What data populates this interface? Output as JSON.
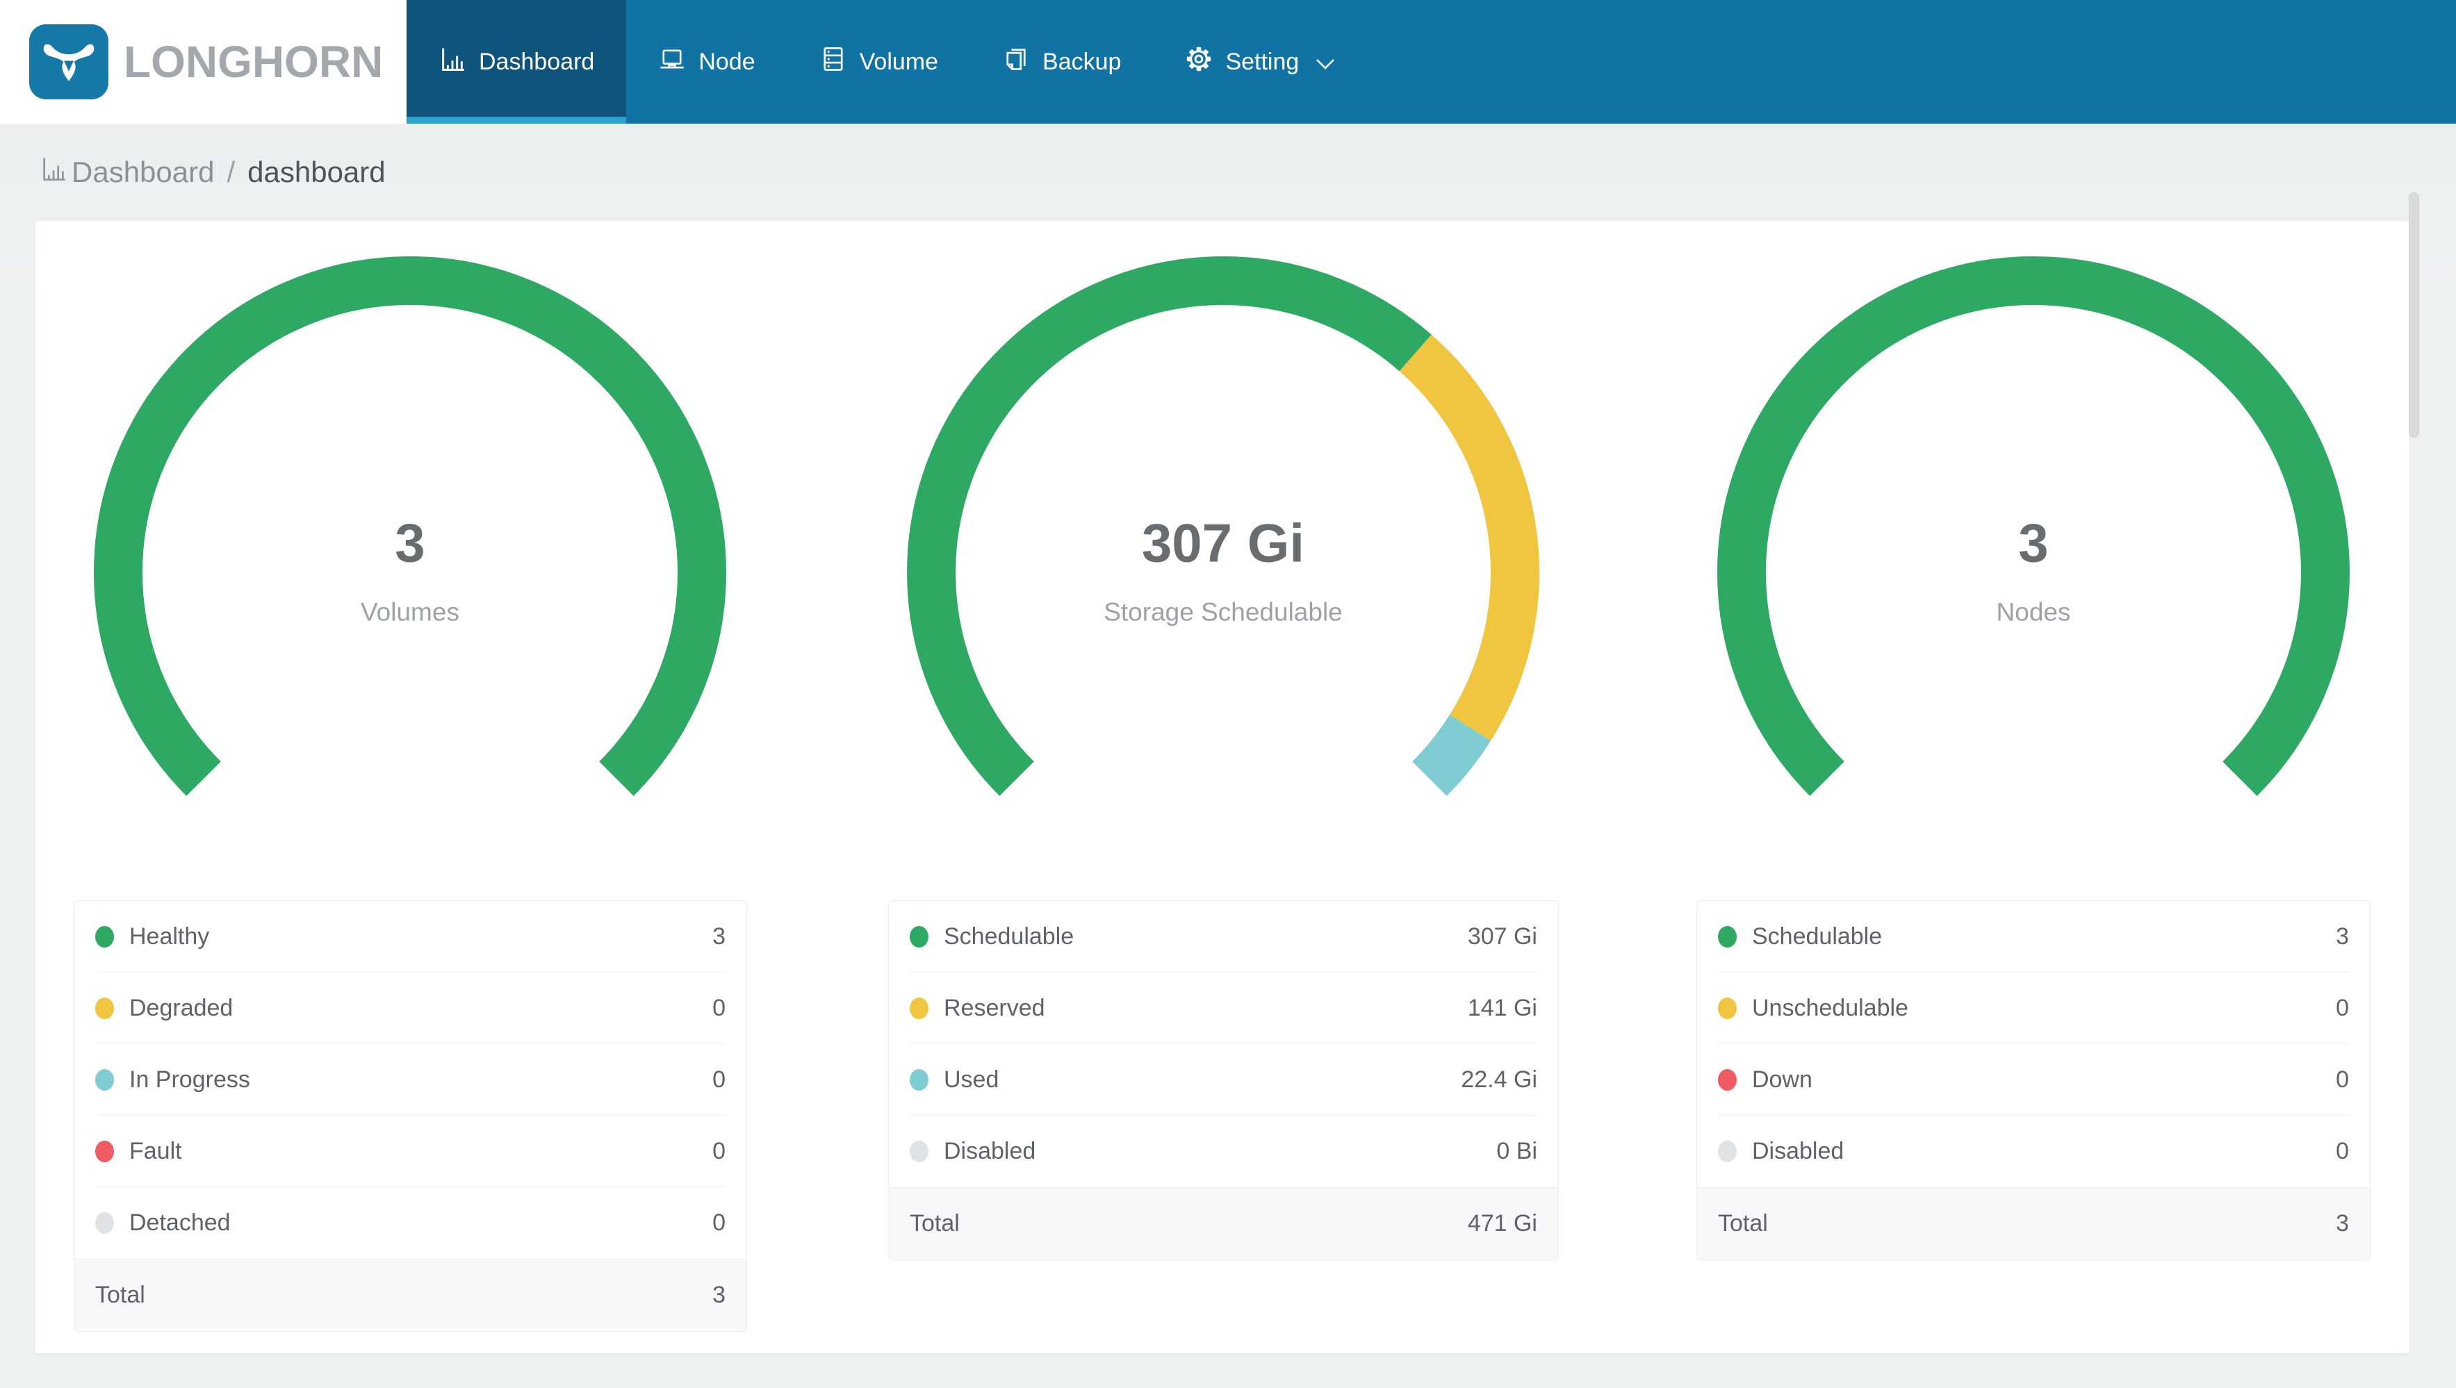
{
  "brand": {
    "name": "LONGHORN",
    "logo_icon": "bull-icon"
  },
  "nav": {
    "items": [
      {
        "label": "Dashboard",
        "icon": "bar-chart-icon",
        "active": true
      },
      {
        "label": "Node",
        "icon": "laptop-icon",
        "active": false
      },
      {
        "label": "Volume",
        "icon": "server-icon",
        "active": false
      },
      {
        "label": "Backup",
        "icon": "copy-icon",
        "active": false
      },
      {
        "label": "Setting",
        "icon": "gear-icon",
        "active": false,
        "has_dropdown": true
      }
    ]
  },
  "breadcrumb": {
    "icon": "bar-chart-icon",
    "section": "Dashboard",
    "separator": "/",
    "page": "dashboard"
  },
  "colors": {
    "nav_bg": "#1173A3",
    "nav_active_bg": "#0E547C",
    "nav_active_strip": "#2BA3CF",
    "brand_blue": "#1679A8",
    "healthy_green": "#2EA963",
    "warning_yellow": "#F0C53F",
    "progress_teal": "#7FCCD3",
    "fault_red": "#F05A62",
    "disabled_gray": "#E0E3E5"
  },
  "gauges": [
    {
      "id": "volumes",
      "center_value": "3",
      "center_label": "Volumes",
      "arc_total_deg": 270,
      "rows": [
        {
          "label": "Healthy",
          "display": "3",
          "value": 3,
          "color": "#2EA963"
        },
        {
          "label": "Degraded",
          "display": "0",
          "value": 0,
          "color": "#F0C53F"
        },
        {
          "label": "In Progress",
          "display": "0",
          "value": 0,
          "color": "#7FCCD3"
        },
        {
          "label": "Fault",
          "display": "0",
          "value": 0,
          "color": "#F05A62"
        },
        {
          "label": "Detached",
          "display": "0",
          "value": 0,
          "color": "#E0E3E5"
        }
      ],
      "total": {
        "label": "Total",
        "display": "3"
      }
    },
    {
      "id": "storage",
      "center_value": "307 Gi",
      "center_label": "Storage Schedulable",
      "arc_total_deg": 270,
      "rows": [
        {
          "label": "Schedulable",
          "display": "307 Gi",
          "value": 307,
          "color": "#2EA963"
        },
        {
          "label": "Reserved",
          "display": "141 Gi",
          "value": 141,
          "color": "#F0C53F"
        },
        {
          "label": "Used",
          "display": "22.4 Gi",
          "value": 22.4,
          "color": "#7FCCD3"
        },
        {
          "label": "Disabled",
          "display": "0 Bi",
          "value": 0,
          "color": "#E0E3E5"
        }
      ],
      "total": {
        "label": "Total",
        "display": "471 Gi"
      }
    },
    {
      "id": "nodes",
      "center_value": "3",
      "center_label": "Nodes",
      "arc_total_deg": 270,
      "rows": [
        {
          "label": "Schedulable",
          "display": "3",
          "value": 3,
          "color": "#2EA963"
        },
        {
          "label": "Unschedulable",
          "display": "0",
          "value": 0,
          "color": "#F0C53F"
        },
        {
          "label": "Down",
          "display": "0",
          "value": 0,
          "color": "#F05A62"
        },
        {
          "label": "Disabled",
          "display": "0",
          "value": 0,
          "color": "#E0E3E5"
        }
      ],
      "total": {
        "label": "Total",
        "display": "3"
      }
    }
  ],
  "layout_note_values_visible_only": true
}
